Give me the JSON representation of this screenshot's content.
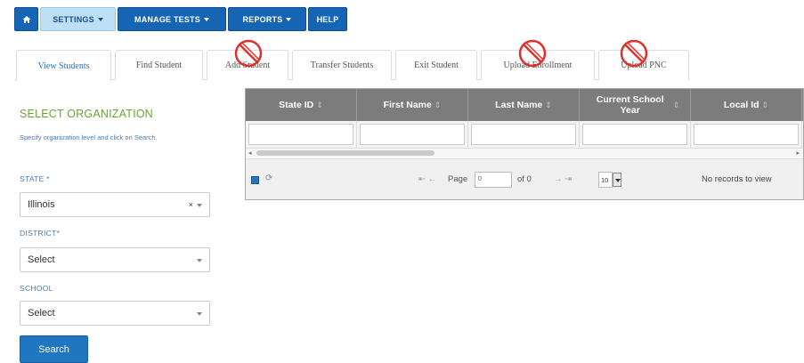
{
  "nav": {
    "home_icon": "home-icon",
    "items": [
      {
        "label": "SETTINGS",
        "active": true
      },
      {
        "label": "MANAGE TESTS"
      },
      {
        "label": "REPORTS"
      },
      {
        "label": "HELP"
      }
    ]
  },
  "tabs": [
    {
      "label": "View Students",
      "active": true
    },
    {
      "label": "Find Student"
    },
    {
      "label": "Add Student",
      "disabled": true
    },
    {
      "label": "Transfer Students"
    },
    {
      "label": "Exit Student"
    },
    {
      "label": "Upload Enrollment",
      "disabled": true
    },
    {
      "label": "Upload PNC",
      "disabled": true
    }
  ],
  "left": {
    "title": "SELECT ORGANIZATION",
    "description": "Specify organization level and click on Search.",
    "state_label": "STATE *",
    "state_value": "Illinois",
    "state_clear": "×",
    "district_label": "DISTRICT*",
    "district_value": "Select",
    "school_label": "SCHOOL",
    "school_value": "Select",
    "search_button": "Search"
  },
  "grid": {
    "columns": [
      {
        "label": "State ID",
        "sort": "⇕"
      },
      {
        "label": "First Name",
        "sort": "⇕"
      },
      {
        "label": "Last Name",
        "sort": "⇕"
      },
      {
        "label": "Current School Year",
        "sort": "⇕"
      },
      {
        "label": "Local Id",
        "sort": "⇕"
      }
    ],
    "pager": {
      "first_prev": "⇤ ←",
      "page_label": "Page",
      "page_value": "0",
      "of_label": "of 0",
      "next_last": "→ ⇥",
      "rows_per_page": "10",
      "no_records": "No records to view"
    }
  }
}
